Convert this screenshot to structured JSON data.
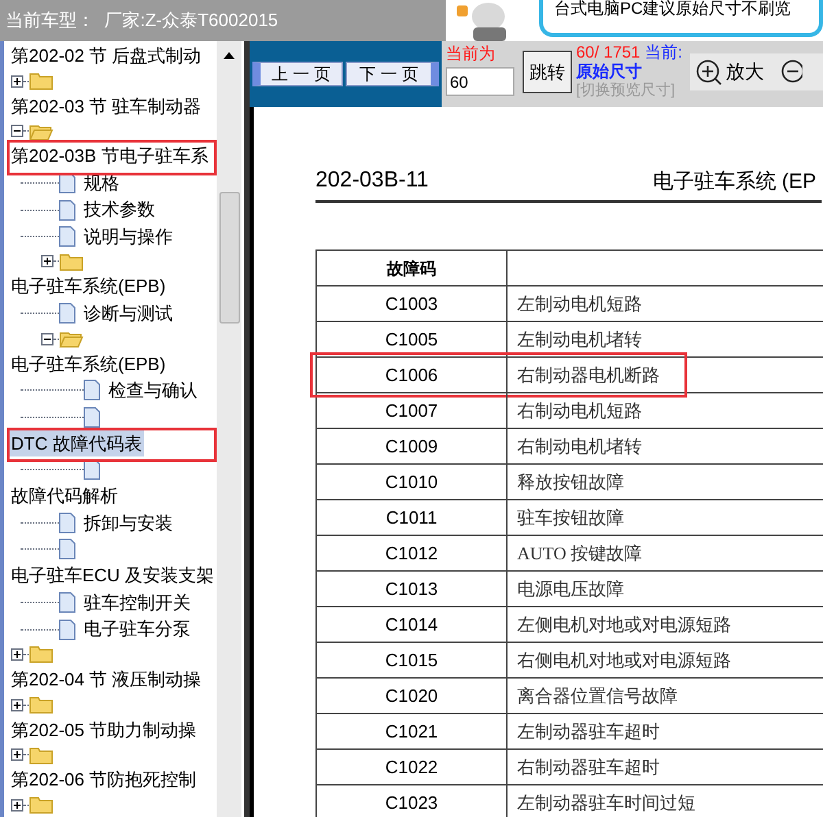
{
  "header": {
    "title": "当前车型：  厂家:Z-众泰T6002015",
    "banner_text": "台式电脑PC建议原始尺寸不刷览"
  },
  "tree": {
    "rows": [
      {
        "kind": "label",
        "label": "第202-02 节 后盘式制动",
        "selected": false,
        "marked": false
      },
      {
        "kind": "folder",
        "expanded": false
      },
      {
        "kind": "label",
        "label": "第202-03 节 驻车制动器",
        "selected": false,
        "marked": false
      },
      {
        "kind": "folder",
        "expanded": true
      },
      {
        "kind": "label",
        "label": "第202-03B 节电子驻车系",
        "selected": false,
        "marked": true
      },
      {
        "kind": "doc",
        "label": "规格"
      },
      {
        "kind": "doc",
        "label": "技术参数"
      },
      {
        "kind": "doc",
        "label": "说明与操作"
      },
      {
        "kind": "subfolder",
        "expanded": false
      },
      {
        "kind": "label",
        "label": "电子驻车系统(EPB)",
        "selected": false,
        "marked": false
      },
      {
        "kind": "doc",
        "label": "诊断与测试"
      },
      {
        "kind": "subfolder",
        "expanded": true
      },
      {
        "kind": "label",
        "label": "电子驻车系统(EPB)",
        "selected": false,
        "marked": false
      },
      {
        "kind": "subdoc",
        "label": "检查与确认"
      },
      {
        "kind": "subdoc"
      },
      {
        "kind": "label",
        "label": "DTC 故障代码表",
        "selected": true,
        "marked": true
      },
      {
        "kind": "subdoc"
      },
      {
        "kind": "label",
        "label": "故障代码解析",
        "selected": false,
        "marked": false
      },
      {
        "kind": "doc",
        "label": "拆卸与安装"
      },
      {
        "kind": "doc"
      },
      {
        "kind": "label",
        "label": "电子驻车ECU 及安装支架",
        "selected": false,
        "marked": false
      },
      {
        "kind": "doc",
        "label": "驻车控制开关"
      },
      {
        "kind": "doc",
        "label": "电子驻车分泵"
      },
      {
        "kind": "folder",
        "expanded": false
      },
      {
        "kind": "label",
        "label": "第202-04 节 液压制动操",
        "selected": false,
        "marked": false
      },
      {
        "kind": "folder",
        "expanded": false
      },
      {
        "kind": "label",
        "label": "第202-05 节助力制动操",
        "selected": false,
        "marked": false
      },
      {
        "kind": "folder",
        "expanded": false
      },
      {
        "kind": "label",
        "label": "第202-06 节防抱死控制",
        "selected": false,
        "marked": false
      },
      {
        "kind": "folder",
        "expanded": false
      }
    ]
  },
  "toolbar": {
    "prev": "上 一 页",
    "next": "下 一 页",
    "current_label": "当前为",
    "page_input": "60",
    "jump": "跳转",
    "page_count": "60/ 1751",
    "current_size_label": "当前:",
    "size": "原始尺寸",
    "switch_size": "[切换预览尺寸]",
    "zoom_in": "放大"
  },
  "document": {
    "page_number": "202-03B-11",
    "section_title": "电子驻车系统 (EP",
    "table": {
      "columns": [
        "故障码"
      ],
      "rows": [
        {
          "code": "C1003",
          "description": "左制动电机短路",
          "marked": false
        },
        {
          "code": "C1005",
          "description": "左制动电机堵转",
          "marked": false
        },
        {
          "code": "C1006",
          "description": "右制动器电机断路",
          "marked": true
        },
        {
          "code": "C1007",
          "description": "右制动电机短路",
          "marked": false
        },
        {
          "code": "C1009",
          "description": "右制动电机堵转",
          "marked": false
        },
        {
          "code": "C1010",
          "description": "释放按钮故障",
          "marked": false
        },
        {
          "code": "C1011",
          "description": "驻车按钮故障",
          "marked": false
        },
        {
          "code": "C1012",
          "description": "AUTO 按键故障",
          "marked": false
        },
        {
          "code": "C1013",
          "description": "电源电压故障",
          "marked": false
        },
        {
          "code": "C1014",
          "description": "左侧电机对地或对电源短路",
          "marked": false
        },
        {
          "code": "C1015",
          "description": "右侧电机对地或对电源短路",
          "marked": false
        },
        {
          "code": "C1020",
          "description": "离合器位置信号故障",
          "marked": false
        },
        {
          "code": "C1021",
          "description": "左制动器驻车超时",
          "marked": false
        },
        {
          "code": "C1022",
          "description": "右制动器驻车超时",
          "marked": false
        },
        {
          "code": "C1023",
          "description": "左制动器驻车时间过短",
          "marked": false
        }
      ]
    }
  }
}
